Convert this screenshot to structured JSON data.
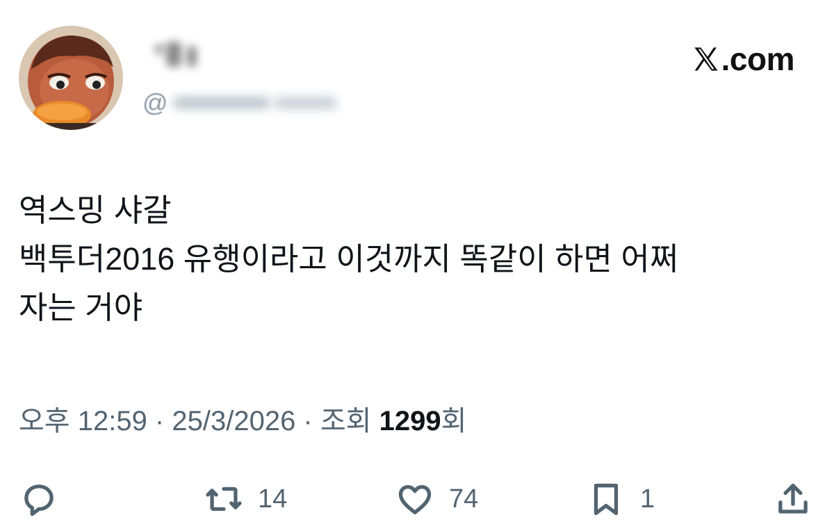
{
  "brand": {
    "name": ".com",
    "logo_icon": "x-logo-icon"
  },
  "author": {
    "handle_prefix": "@"
  },
  "tweet": {
    "text": "역스밍 샤갈\n백투더2016 유행이라고 이것까지 똑같이 하면 어쩌\n자는 거야"
  },
  "meta": {
    "time": "오후 12:59",
    "separator1": " · ",
    "date": "25/3/2026",
    "separator2": " · ",
    "views_label": "조회 ",
    "views_count": "1299",
    "views_suffix": "회"
  },
  "actions": {
    "reply": {
      "icon": "reply-icon",
      "count": ""
    },
    "retweet": {
      "icon": "retweet-icon",
      "count": "14"
    },
    "like": {
      "icon": "heart-icon",
      "count": "74"
    },
    "bookmark": {
      "icon": "bookmark-icon",
      "count": "1"
    },
    "share": {
      "icon": "share-icon"
    }
  },
  "colors": {
    "text": "#0f1419",
    "muted": "#536471",
    "background": "#ffffff"
  }
}
